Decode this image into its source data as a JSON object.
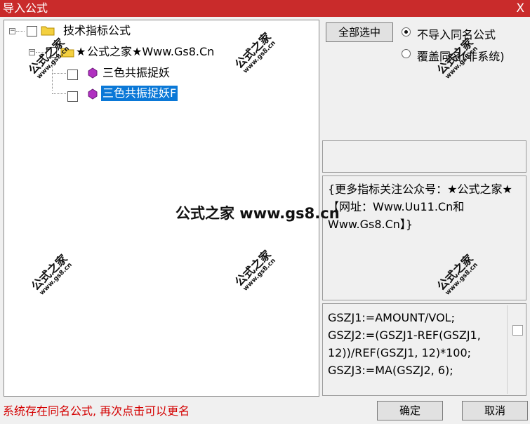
{
  "window": {
    "title": "导入公式",
    "close_label": "X"
  },
  "tree": {
    "root": {
      "expander": "−",
      "label": "技术指标公式"
    },
    "group": {
      "expander": "−",
      "label": "公式之家★Www.Gs8.Cn",
      "label_prefix": "★"
    },
    "items": [
      {
        "label": "三色共振捉妖",
        "selected": false
      },
      {
        "label": "三色共振捉妖F",
        "selected": true
      }
    ]
  },
  "buttons": {
    "select_all": "全部选中",
    "ok": "确定",
    "cancel": "取消"
  },
  "options": {
    "no_import": {
      "label": "不导入同名公式",
      "checked": true
    },
    "overwrite": {
      "label": "覆盖同名(非系统)",
      "checked": false
    }
  },
  "description": "{更多指标关注公众号：★公式之家★ 【网址：Www.Uu11.Cn和Www.Gs8.Cn】}",
  "code": [
    "GSZJ1:=AMOUNT/VOL;",
    "GSZJ2:=(GSZJ1-REF(GSZJ1,",
    "12))/REF(GSZJ1, 12)*100;",
    "GSZJ3:=MA(GSZJ2, 6);"
  ],
  "status": "系统存在同名公式, 再次点击可以更名",
  "watermark": {
    "main": "公式之家",
    "sub": "www.gs8.cn",
    "center": "公式之家 www.gs8.cn"
  },
  "colors": {
    "titlebar": "#c92b2b",
    "selection": "#0a78d7",
    "status": "#d40000"
  }
}
